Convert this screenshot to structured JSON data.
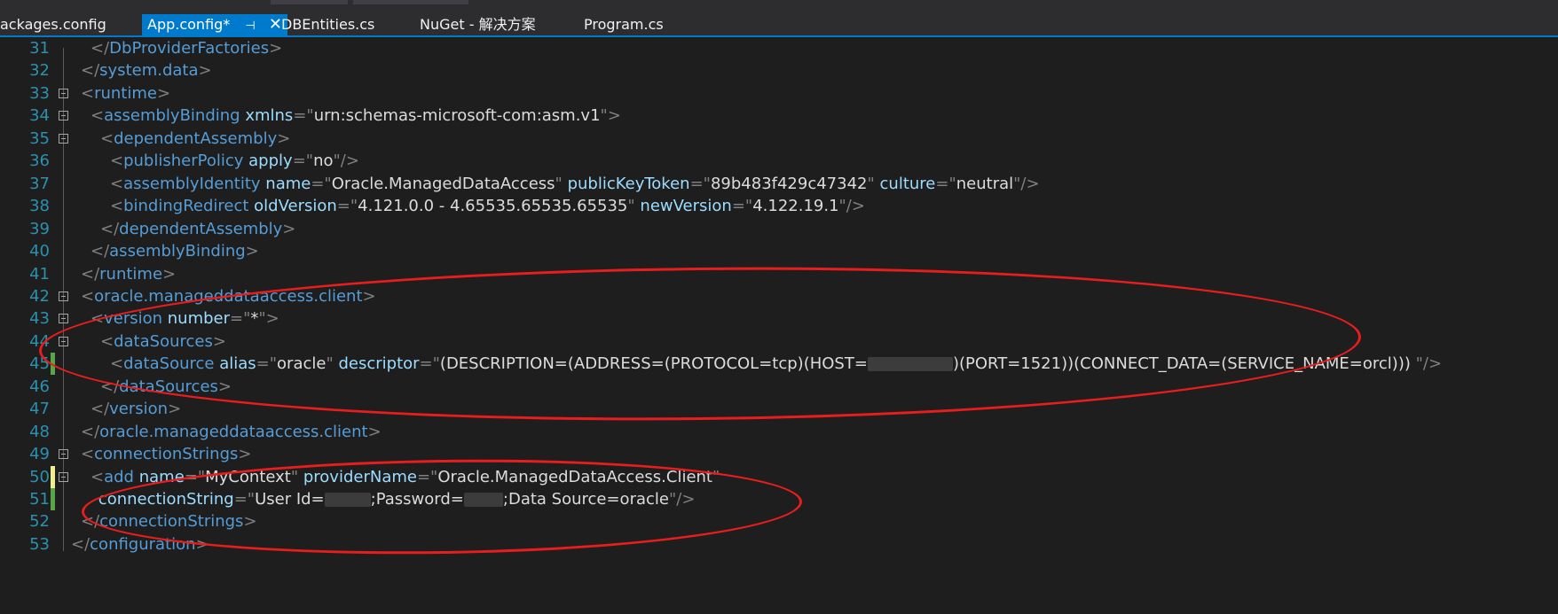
{
  "tabs": [
    {
      "label": "ackages.config",
      "active": false
    },
    {
      "label": "App.config*",
      "active": true,
      "pin_glyph": "⊣",
      "close_glyph": "✕"
    },
    {
      "label": "DBEntities.cs",
      "active": false
    },
    {
      "label": "NuGet - 解决方案",
      "active": false
    },
    {
      "label": "Program.cs",
      "active": false
    }
  ],
  "colors": {
    "tag": "#569cd6",
    "attribute": "#9cdcfe",
    "delimiter": "#808080",
    "value": "#dcdcdc",
    "line_number": "#2b91af",
    "annotation_ellipse": "#e81d1d",
    "change_saved": "#57a64a",
    "change_unsaved": "#efef8e"
  },
  "lines": [
    {
      "n": "31",
      "indent": 2,
      "fold": false,
      "change": null,
      "tokens": [
        [
          "d",
          "</"
        ],
        [
          "t",
          "DbProviderFactories"
        ],
        [
          "d",
          ">"
        ]
      ]
    },
    {
      "n": "32",
      "indent": 1,
      "fold": false,
      "change": null,
      "tokens": [
        [
          "d",
          "</"
        ],
        [
          "t",
          "system.data"
        ],
        [
          "d",
          ">"
        ]
      ]
    },
    {
      "n": "33",
      "indent": 1,
      "fold": true,
      "change": null,
      "tokens": [
        [
          "d",
          "<"
        ],
        [
          "t",
          "runtime"
        ],
        [
          "d",
          ">"
        ]
      ]
    },
    {
      "n": "34",
      "indent": 2,
      "fold": true,
      "change": null,
      "tokens": [
        [
          "d",
          "<"
        ],
        [
          "t",
          "assemblyBinding"
        ],
        [
          "v",
          " "
        ],
        [
          "a",
          "xmlns"
        ],
        [
          "d",
          "=\""
        ],
        [
          "v",
          "urn:schemas-microsoft-com:asm.v1"
        ],
        [
          "d",
          "\">"
        ]
      ]
    },
    {
      "n": "35",
      "indent": 3,
      "fold": true,
      "change": null,
      "tokens": [
        [
          "d",
          "<"
        ],
        [
          "t",
          "dependentAssembly"
        ],
        [
          "d",
          ">"
        ]
      ]
    },
    {
      "n": "36",
      "indent": 4,
      "fold": false,
      "change": null,
      "tokens": [
        [
          "d",
          "<"
        ],
        [
          "t",
          "publisherPolicy"
        ],
        [
          "v",
          " "
        ],
        [
          "a",
          "apply"
        ],
        [
          "d",
          "=\""
        ],
        [
          "v",
          "no"
        ],
        [
          "d",
          "\"/>"
        ]
      ]
    },
    {
      "n": "37",
      "indent": 4,
      "fold": false,
      "change": null,
      "tokens": [
        [
          "d",
          "<"
        ],
        [
          "t",
          "assemblyIdentity"
        ],
        [
          "v",
          " "
        ],
        [
          "a",
          "name"
        ],
        [
          "d",
          "=\""
        ],
        [
          "v",
          "Oracle.ManagedDataAccess"
        ],
        [
          "d",
          "\""
        ],
        [
          "v",
          " "
        ],
        [
          "a",
          "publicKeyToken"
        ],
        [
          "d",
          "=\""
        ],
        [
          "v",
          "89b483f429c47342"
        ],
        [
          "d",
          "\""
        ],
        [
          "v",
          " "
        ],
        [
          "a",
          "culture"
        ],
        [
          "d",
          "=\""
        ],
        [
          "v",
          "neutral"
        ],
        [
          "d",
          "\"/>"
        ]
      ]
    },
    {
      "n": "38",
      "indent": 4,
      "fold": false,
      "change": null,
      "tokens": [
        [
          "d",
          "<"
        ],
        [
          "t",
          "bindingRedirect"
        ],
        [
          "v",
          " "
        ],
        [
          "a",
          "oldVersion"
        ],
        [
          "d",
          "=\""
        ],
        [
          "v",
          "4.121.0.0 - 4.65535.65535.65535"
        ],
        [
          "d",
          "\""
        ],
        [
          "v",
          " "
        ],
        [
          "a",
          "newVersion"
        ],
        [
          "d",
          "=\""
        ],
        [
          "v",
          "4.122.19.1"
        ],
        [
          "d",
          "\"/>"
        ]
      ]
    },
    {
      "n": "39",
      "indent": 3,
      "fold": false,
      "change": null,
      "tokens": [
        [
          "d",
          "</"
        ],
        [
          "t",
          "dependentAssembly"
        ],
        [
          "d",
          ">"
        ]
      ]
    },
    {
      "n": "40",
      "indent": 2,
      "fold": false,
      "change": null,
      "tokens": [
        [
          "d",
          "</"
        ],
        [
          "t",
          "assemblyBinding"
        ],
        [
          "d",
          ">"
        ]
      ]
    },
    {
      "n": "41",
      "indent": 1,
      "fold": false,
      "change": null,
      "tokens": [
        [
          "d",
          "</"
        ],
        [
          "t",
          "runtime"
        ],
        [
          "d",
          ">"
        ]
      ]
    },
    {
      "n": "42",
      "indent": 1,
      "fold": true,
      "change": null,
      "tokens": [
        [
          "d",
          "<"
        ],
        [
          "t",
          "oracle.manageddataaccess.client"
        ],
        [
          "d",
          ">"
        ]
      ]
    },
    {
      "n": "43",
      "indent": 2,
      "fold": true,
      "change": null,
      "tokens": [
        [
          "d",
          "<"
        ],
        [
          "t",
          "version"
        ],
        [
          "v",
          " "
        ],
        [
          "a",
          "number"
        ],
        [
          "d",
          "=\""
        ],
        [
          "v",
          "*"
        ],
        [
          "d",
          "\">"
        ]
      ]
    },
    {
      "n": "44",
      "indent": 3,
      "fold": true,
      "change": null,
      "tokens": [
        [
          "d",
          "<"
        ],
        [
          "t",
          "dataSources"
        ],
        [
          "d",
          ">"
        ]
      ]
    },
    {
      "n": "45",
      "indent": 4,
      "fold": false,
      "change": "saved",
      "tokens": [
        [
          "d",
          "<"
        ],
        [
          "t",
          "dataSource"
        ],
        [
          "v",
          " "
        ],
        [
          "a",
          "alias"
        ],
        [
          "d",
          "=\""
        ],
        [
          "v",
          "oracle"
        ],
        [
          "d",
          "\""
        ],
        [
          "v",
          " "
        ],
        [
          "a",
          "descriptor"
        ],
        [
          "d",
          "=\""
        ],
        [
          "v",
          "(DESCRIPTION=(ADDRESS=(PROTOCOL=tcp)(HOST="
        ],
        [
          "r",
          "96"
        ],
        [
          "v",
          ")(PORT=1521))(CONNECT_DATA=(SERVICE_NAME=orcl))) "
        ],
        [
          "d",
          "\"/>"
        ]
      ]
    },
    {
      "n": "46",
      "indent": 3,
      "fold": false,
      "change": null,
      "tokens": [
        [
          "d",
          "</"
        ],
        [
          "t",
          "dataSources"
        ],
        [
          "d",
          ">"
        ]
      ]
    },
    {
      "n": "47",
      "indent": 2,
      "fold": false,
      "change": null,
      "tokens": [
        [
          "d",
          "</"
        ],
        [
          "t",
          "version"
        ],
        [
          "d",
          ">"
        ]
      ]
    },
    {
      "n": "48",
      "indent": 1,
      "fold": false,
      "change": null,
      "tokens": [
        [
          "d",
          "</"
        ],
        [
          "t",
          "oracle.manageddataaccess.client"
        ],
        [
          "d",
          ">"
        ]
      ]
    },
    {
      "n": "49",
      "indent": 1,
      "fold": true,
      "change": null,
      "tokens": [
        [
          "d",
          "<"
        ],
        [
          "t",
          "connectionStrings"
        ],
        [
          "d",
          ">"
        ]
      ]
    },
    {
      "n": "50",
      "indent": 2,
      "fold": true,
      "change": "unsaved",
      "tokens": [
        [
          "d",
          "<"
        ],
        [
          "t",
          "add"
        ],
        [
          "v",
          " "
        ],
        [
          "a",
          "name"
        ],
        [
          "d",
          "=\""
        ],
        [
          "v",
          "MyContext"
        ],
        [
          "d",
          "\""
        ],
        [
          "v",
          " "
        ],
        [
          "a",
          "providerName"
        ],
        [
          "d",
          "=\""
        ],
        [
          "v",
          "Oracle.ManagedDataAccess.Client"
        ],
        [
          "d",
          "\""
        ]
      ]
    },
    {
      "n": "51",
      "indent": 2.8,
      "fold": false,
      "change": "saved",
      "tokens": [
        [
          "a",
          "connectionString"
        ],
        [
          "d",
          "=\""
        ],
        [
          "v",
          "User Id="
        ],
        [
          "r",
          "52"
        ],
        [
          "v",
          ";Password="
        ],
        [
          "r",
          "44"
        ],
        [
          "v",
          ";Data Source=oracle"
        ],
        [
          "d",
          "\"/>"
        ]
      ]
    },
    {
      "n": "52",
      "indent": 1,
      "fold": false,
      "change": null,
      "tokens": [
        [
          "d",
          "</"
        ],
        [
          "t",
          "connectionStrings"
        ],
        [
          "d",
          ">"
        ]
      ]
    },
    {
      "n": "53",
      "indent": 0,
      "fold": false,
      "change": null,
      "tokens": [
        [
          "d",
          "</"
        ],
        [
          "t",
          "configuration"
        ],
        [
          "d",
          ">"
        ]
      ]
    }
  ]
}
